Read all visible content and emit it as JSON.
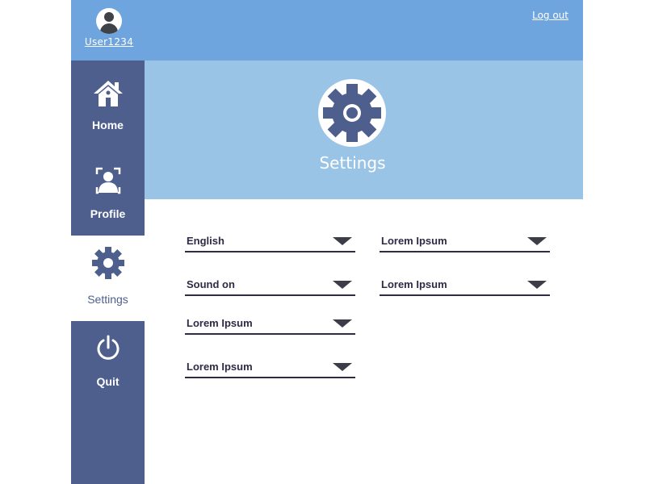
{
  "header": {
    "username": "User1234",
    "logout_label": "Log out"
  },
  "sidebar": {
    "items": [
      {
        "label": "Home",
        "icon": "home-icon"
      },
      {
        "label": "Profile",
        "icon": "profile-icon"
      },
      {
        "label": "Settings",
        "icon": "gear-icon",
        "active": true
      },
      {
        "label": "Quit",
        "icon": "power-icon"
      }
    ]
  },
  "banner": {
    "title": "Settings",
    "icon": "gear-icon"
  },
  "settings": {
    "dropdowns": [
      {
        "value": "English"
      },
      {
        "value": "Lorem Ipsum"
      },
      {
        "value": "Sound on"
      },
      {
        "value": "Lorem Ipsum"
      },
      {
        "value": "Lorem Ipsum"
      },
      {
        "value": "Lorem Ipsum"
      }
    ]
  },
  "colors": {
    "topbar": "#6fa5de",
    "sidebar": "#4e5f8e",
    "banner": "#9ac4e6",
    "text_dark": "#2d2b45"
  }
}
